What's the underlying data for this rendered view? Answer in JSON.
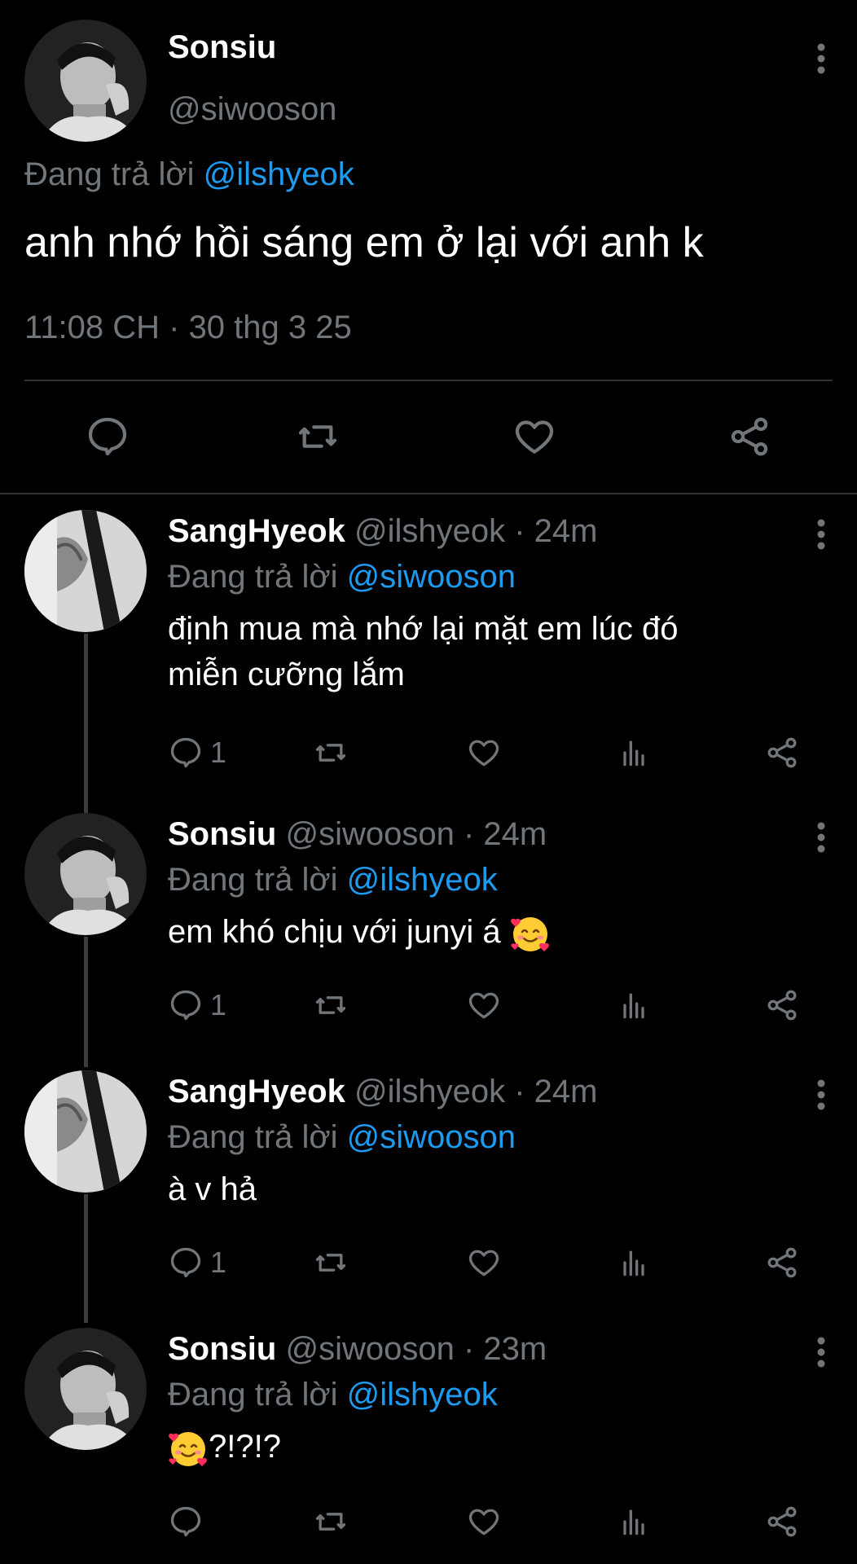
{
  "main": {
    "name": "Sonsiu",
    "handle": "@siwooson",
    "reply_prefix": "Đang trả lời",
    "reply_to": "@ilshyeok",
    "text": "anh nhớ hồi sáng em ở lại với anh k",
    "timestamp": "11:08 CH · 30 thg 3 25",
    "actions": [
      "reply-icon",
      "retweet-icon",
      "like-icon",
      "share-icon"
    ]
  },
  "replies": [
    {
      "name": "SangHyeok",
      "handle": "@ilshyeok",
      "age": "24m",
      "reply_prefix": "Đang trả lời",
      "reply_to": "@siwooson",
      "text_line1": "định mua mà nhớ lại mặt em lúc đó",
      "text_line2": "miễn cưỡng lắm",
      "reply_count": "1"
    },
    {
      "name": "Sonsiu",
      "handle": "@siwooson",
      "age": "24m",
      "reply_prefix": "Đang trả lời",
      "reply_to": "@ilshyeok",
      "text_line1": "em khó chịu với junyi á",
      "emoji": "smiling-face-with-hearts",
      "reply_count": "1"
    },
    {
      "name": "SangHyeok",
      "handle": "@ilshyeok",
      "age": "24m",
      "reply_prefix": "Đang trả lời",
      "reply_to": "@siwooson",
      "text_line1": "à v hả",
      "reply_count": "1"
    },
    {
      "name": "Sonsiu",
      "handle": "@siwooson",
      "age": "23m",
      "reply_prefix": "Đang trả lời",
      "reply_to": "@ilshyeok",
      "emoji": "smiling-face-with-hearts",
      "text_line1": "?!?!?",
      "reply_count": ""
    }
  ],
  "colors": {
    "background": "#000000",
    "text": "#e7e9ea",
    "muted": "#71767b",
    "link": "#1d9bf0",
    "divider": "#2f3336"
  }
}
